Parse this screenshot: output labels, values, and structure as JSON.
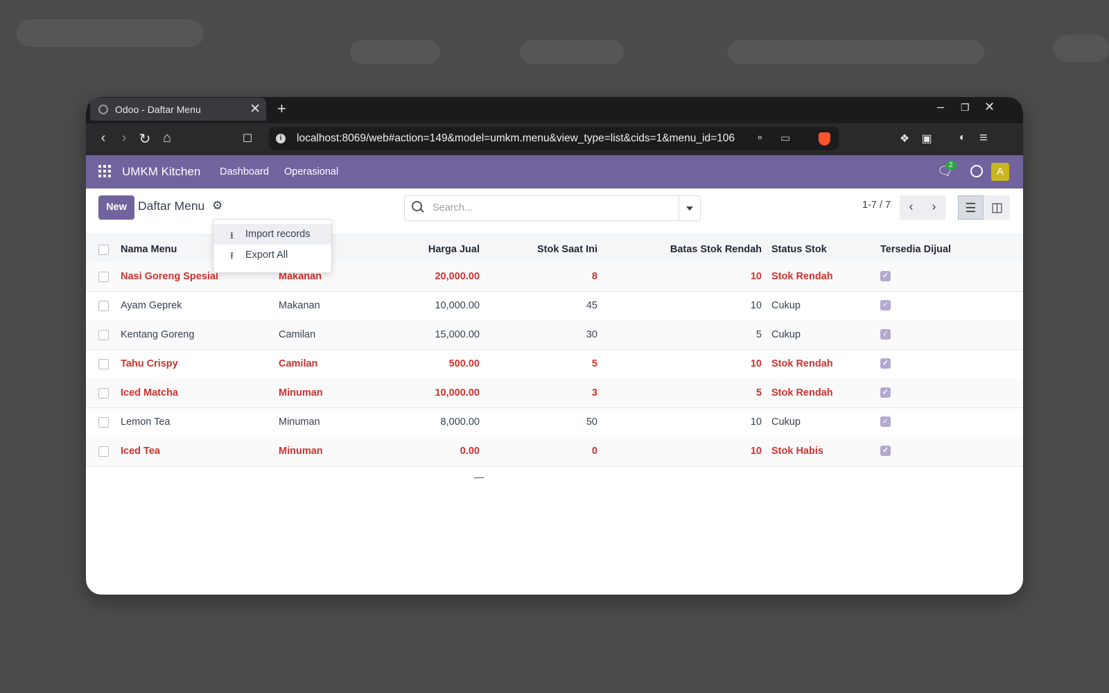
{
  "browser": {
    "tab_title": "Odoo - Daftar Menu",
    "tab_close": "✕",
    "new_tab": "+",
    "url": "localhost:8069/web#action=149&model=umkm.menu&view_type=list&cids=1&menu_id=106"
  },
  "odoo": {
    "brand": "UMKM Kitchen",
    "menu": [
      "Dashboard",
      "Operasional"
    ],
    "message_count": "2",
    "avatar_letter": "A",
    "theme_color": "#71639e"
  },
  "control": {
    "new_label": "New",
    "title": "Daftar Menu",
    "search_placeholder": "Search...",
    "pager": "1-7 / 7"
  },
  "dropdown": {
    "items": [
      "Import records",
      "Export All"
    ]
  },
  "table": {
    "columns": [
      "Nama Menu",
      "Harga Jual",
      "Stok Saat Ini",
      "Batas Stok Rendah",
      "Status Stok",
      "Tersedia Dijual"
    ],
    "rows": [
      {
        "nama": "Nasi Goreng Spesial",
        "kategori": "Makanan",
        "harga": "20,000.00",
        "stok": "8",
        "batas": "10",
        "status": "Stok Rendah",
        "warn": true
      },
      {
        "nama": "Ayam Geprek",
        "kategori": "Makanan",
        "harga": "10,000.00",
        "stok": "45",
        "batas": "10",
        "status": "Cukup",
        "warn": false
      },
      {
        "nama": "Kentang Goreng",
        "kategori": "Camilan",
        "harga": "15,000.00",
        "stok": "30",
        "batas": "5",
        "status": "Cukup",
        "warn": false
      },
      {
        "nama": "Tahu Crispy",
        "kategori": "Camilan",
        "harga": "500.00",
        "stok": "5",
        "batas": "10",
        "status": "Stok Rendah",
        "warn": true
      },
      {
        "nama": "Iced Matcha",
        "kategori": "Minuman",
        "harga": "10,000.00",
        "stok": "3",
        "batas": "5",
        "status": "Stok Rendah",
        "warn": true
      },
      {
        "nama": "Lemon Tea",
        "kategori": "Minuman",
        "harga": "8,000.00",
        "stok": "50",
        "batas": "10",
        "status": "Cukup",
        "warn": false
      },
      {
        "nama": "Iced Tea",
        "kategori": "Minuman",
        "harga": "0.00",
        "stok": "0",
        "batas": "10",
        "status": "Stok Habis",
        "warn": true
      }
    ],
    "aggregate": "—",
    "danger_color": "#d0312d"
  }
}
